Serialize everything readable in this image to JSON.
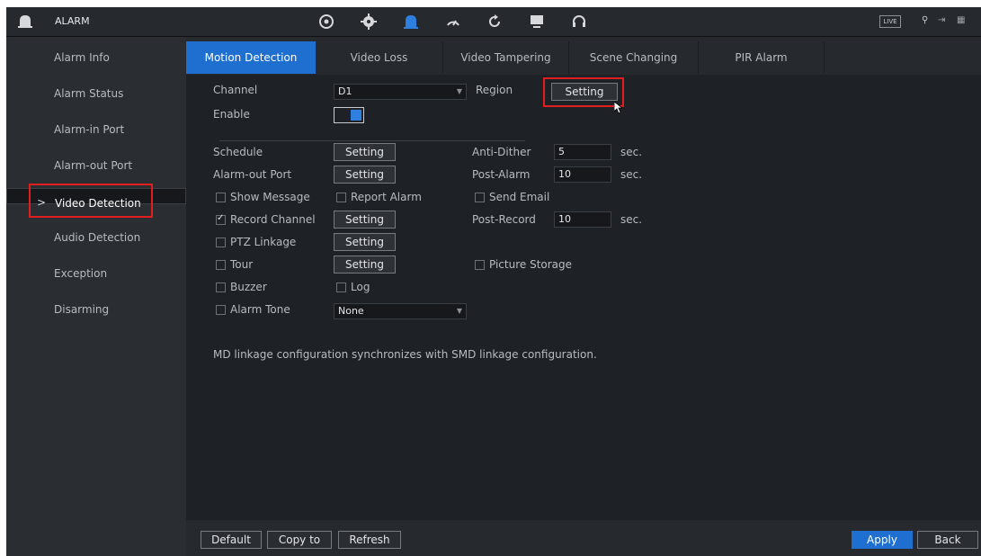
{
  "app": {
    "title": "ALARM",
    "icon": "alarm-bell-icon"
  },
  "top_icons": [
    {
      "name": "camera-settings-icon",
      "glyph": "⊛"
    },
    {
      "name": "network-icon",
      "glyph": "✺"
    },
    {
      "name": "alarm-icon",
      "glyph": "▲"
    },
    {
      "name": "storage-icon",
      "glyph": "◠"
    },
    {
      "name": "sync-icon",
      "glyph": "↻"
    },
    {
      "name": "monitor-icon",
      "glyph": "▭"
    },
    {
      "name": "headset-icon",
      "glyph": "∩"
    }
  ],
  "topbar_right": {
    "live_label": "LIVE",
    "user_icon": "user-icon",
    "logout_icon": "logout-icon",
    "grid_icon": "grid-icon"
  },
  "sidebar": {
    "items": [
      {
        "label": "Alarm Info"
      },
      {
        "label": "Alarm Status"
      },
      {
        "label": "Alarm-in Port"
      },
      {
        "label": "Alarm-out Port"
      },
      {
        "label": "Video Detection",
        "selected": true
      },
      {
        "label": "Audio Detection"
      },
      {
        "label": "Exception"
      },
      {
        "label": "Disarming"
      }
    ],
    "selected_arrow": ">"
  },
  "tabs": [
    {
      "label": "Motion Detection",
      "active": true
    },
    {
      "label": "Video Loss"
    },
    {
      "label": "Video Tampering"
    },
    {
      "label": "Scene Changing"
    },
    {
      "label": "PIR Alarm"
    }
  ],
  "form": {
    "channel_label": "Channel",
    "channel_value": "D1",
    "region_label": "Region",
    "region_button": "Setting",
    "enable_label": "Enable",
    "enable_on": true,
    "schedule_label": "Schedule",
    "schedule_button": "Setting",
    "anti_dither_label": "Anti-Dither",
    "anti_dither_value": "5",
    "anti_dither_unit": "sec.",
    "alarm_out_label": "Alarm-out Port",
    "alarm_out_button": "Setting",
    "post_alarm_label": "Post-Alarm",
    "post_alarm_value": "10",
    "post_alarm_unit": "sec.",
    "show_message_label": "Show Message",
    "report_alarm_label": "Report Alarm",
    "send_email_label": "Send Email",
    "record_channel_label": "Record Channel",
    "record_channel_checked": true,
    "record_channel_button": "Setting",
    "post_record_label": "Post-Record",
    "post_record_value": "10",
    "post_record_unit": "sec.",
    "ptz_label": "PTZ Linkage",
    "ptz_button": "Setting",
    "tour_label": "Tour",
    "tour_button": "Setting",
    "picture_storage_label": "Picture Storage",
    "buzzer_label": "Buzzer",
    "log_label": "Log",
    "alarm_tone_label": "Alarm Tone",
    "alarm_tone_value": "None",
    "note": "MD linkage configuration synchronizes with SMD linkage configuration."
  },
  "bottom": {
    "default_label": "Default",
    "copy_to_label": "Copy to",
    "refresh_label": "Refresh",
    "apply_label": "Apply",
    "back_label": "Back"
  },
  "colors": {
    "accent": "#1e6fcf",
    "highlight": "#e01e1e",
    "background": "#1e2125"
  }
}
